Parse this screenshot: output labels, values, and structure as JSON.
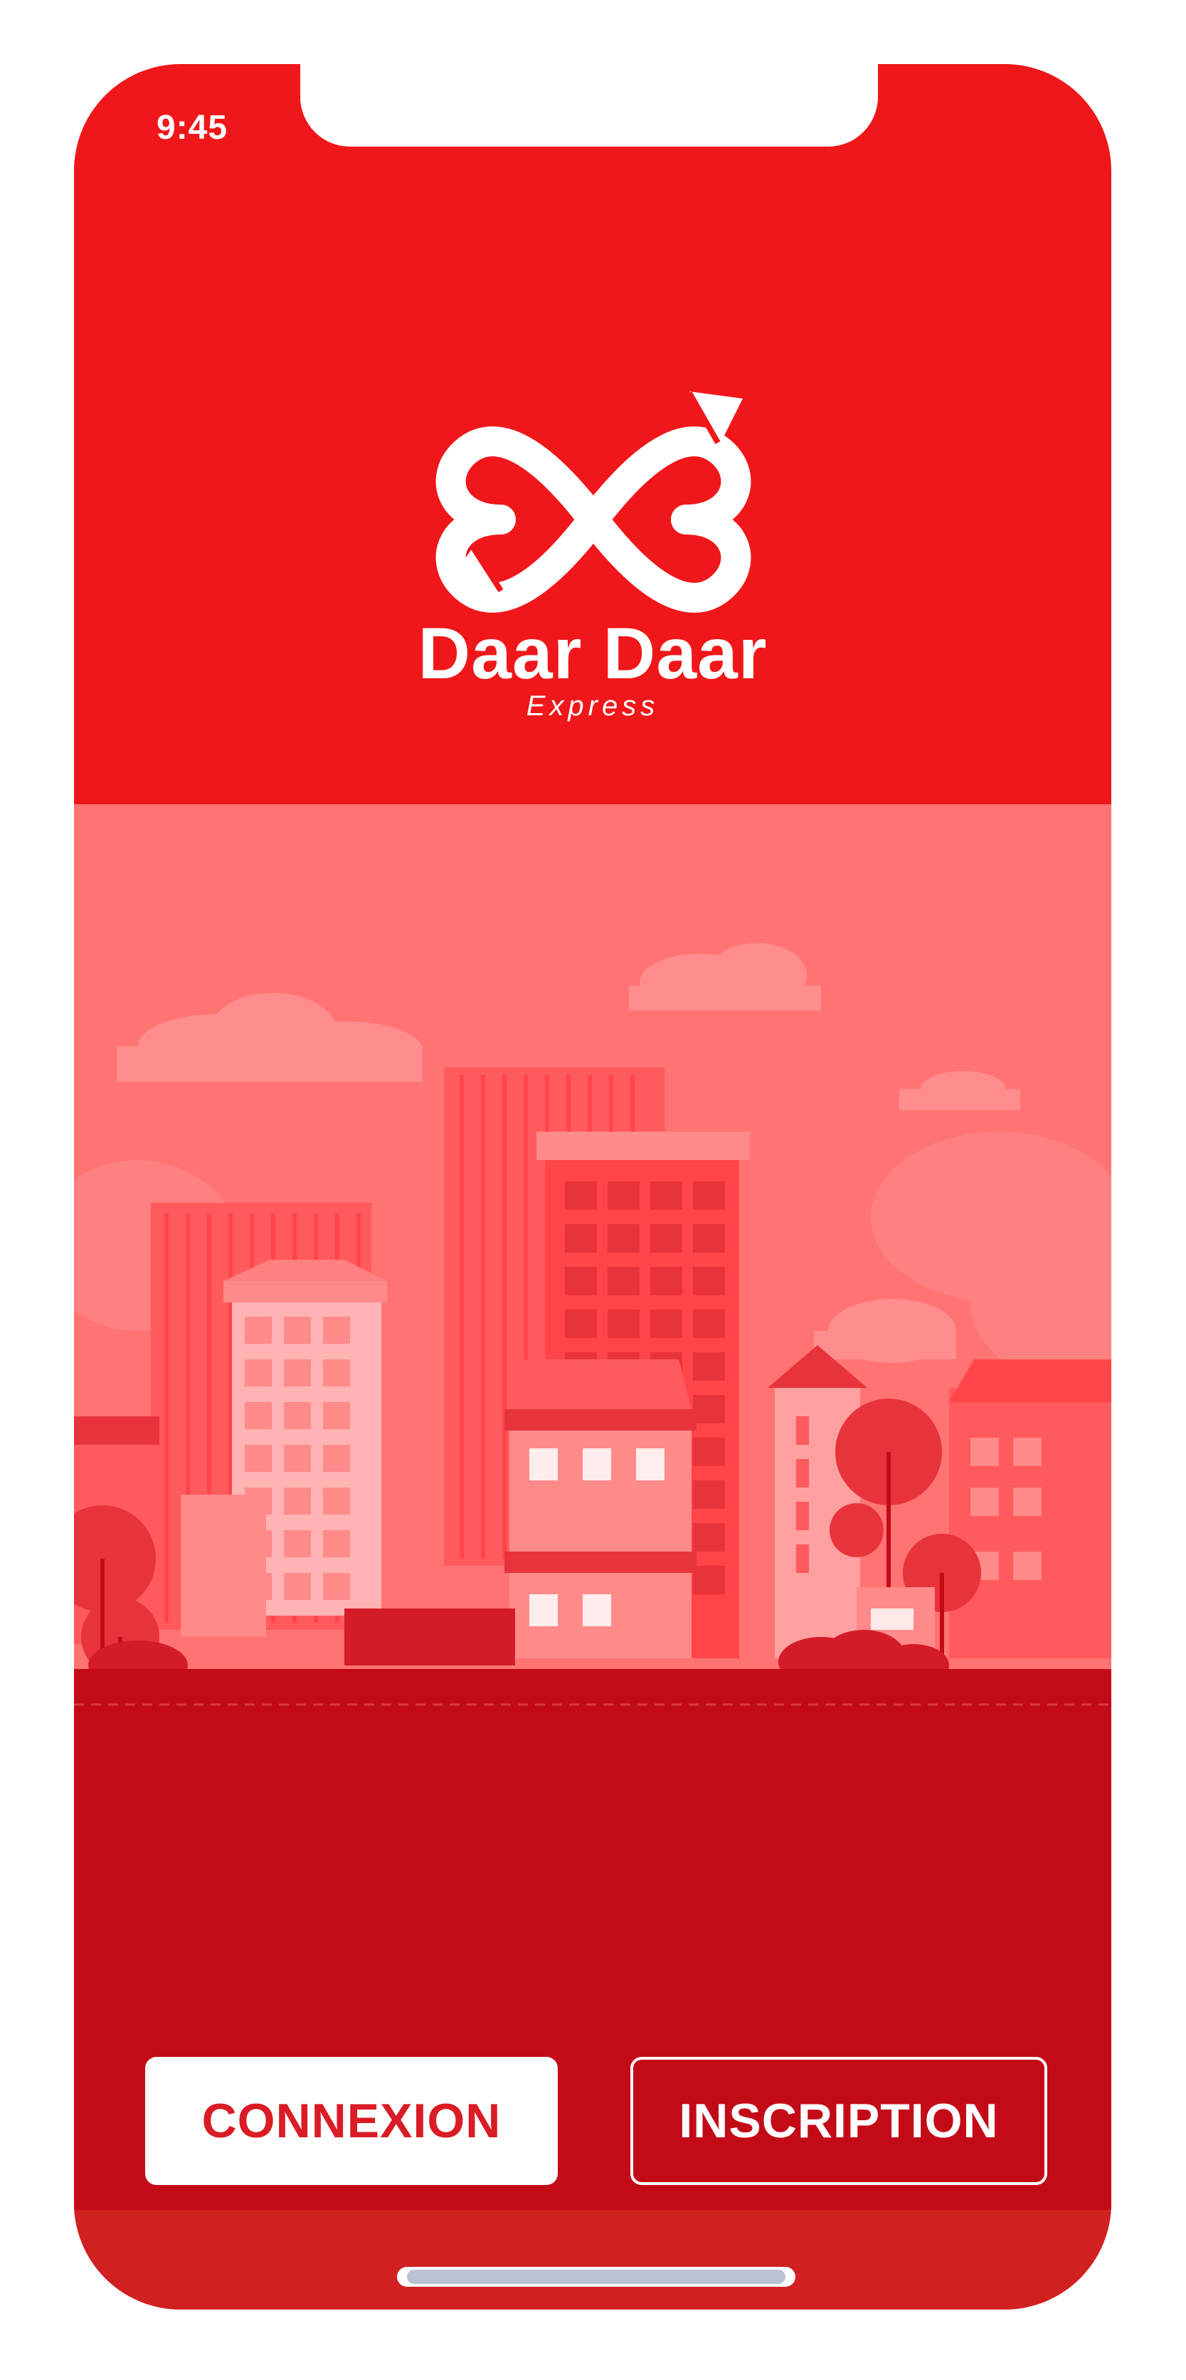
{
  "status_bar": {
    "time": "9:45"
  },
  "brand": {
    "name": "Daar Daar",
    "tagline": "Express",
    "logo_icon": "infinity-arrows-icon"
  },
  "illustration": {
    "subject": "city-skyline"
  },
  "actions": {
    "login_label": "CONNEXION",
    "signup_label": "INSCRIPTION"
  },
  "colors": {
    "brand_red": "#f0171a",
    "sky": "#ff7373",
    "ground": "#c30b18",
    "button_text": "#d91c25"
  }
}
